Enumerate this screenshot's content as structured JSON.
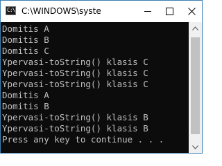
{
  "window": {
    "title": "C:\\WINDOWS\\syste",
    "icon": "console-icon"
  },
  "titlebar": {
    "buttons": [
      "minimize-icon",
      "maximize-icon",
      "close-icon"
    ]
  },
  "console": {
    "lines": [
      "Domitis A",
      "Domitis B",
      "Domitis C",
      "Ypervasi-toString() klasis C",
      "Ypervasi-toString() klasis C",
      "Ypervasi-toString() klasis C",
      "Domitis A",
      "Domitis B",
      "Ypervasi-toString() klasis B",
      "Ypervasi-toString() klasis B",
      "Press any key to continue . . ."
    ]
  },
  "scrollbar": {
    "icons": [
      "scroll-up-arrow-icon",
      "scroll-down-arrow-icon"
    ]
  }
}
